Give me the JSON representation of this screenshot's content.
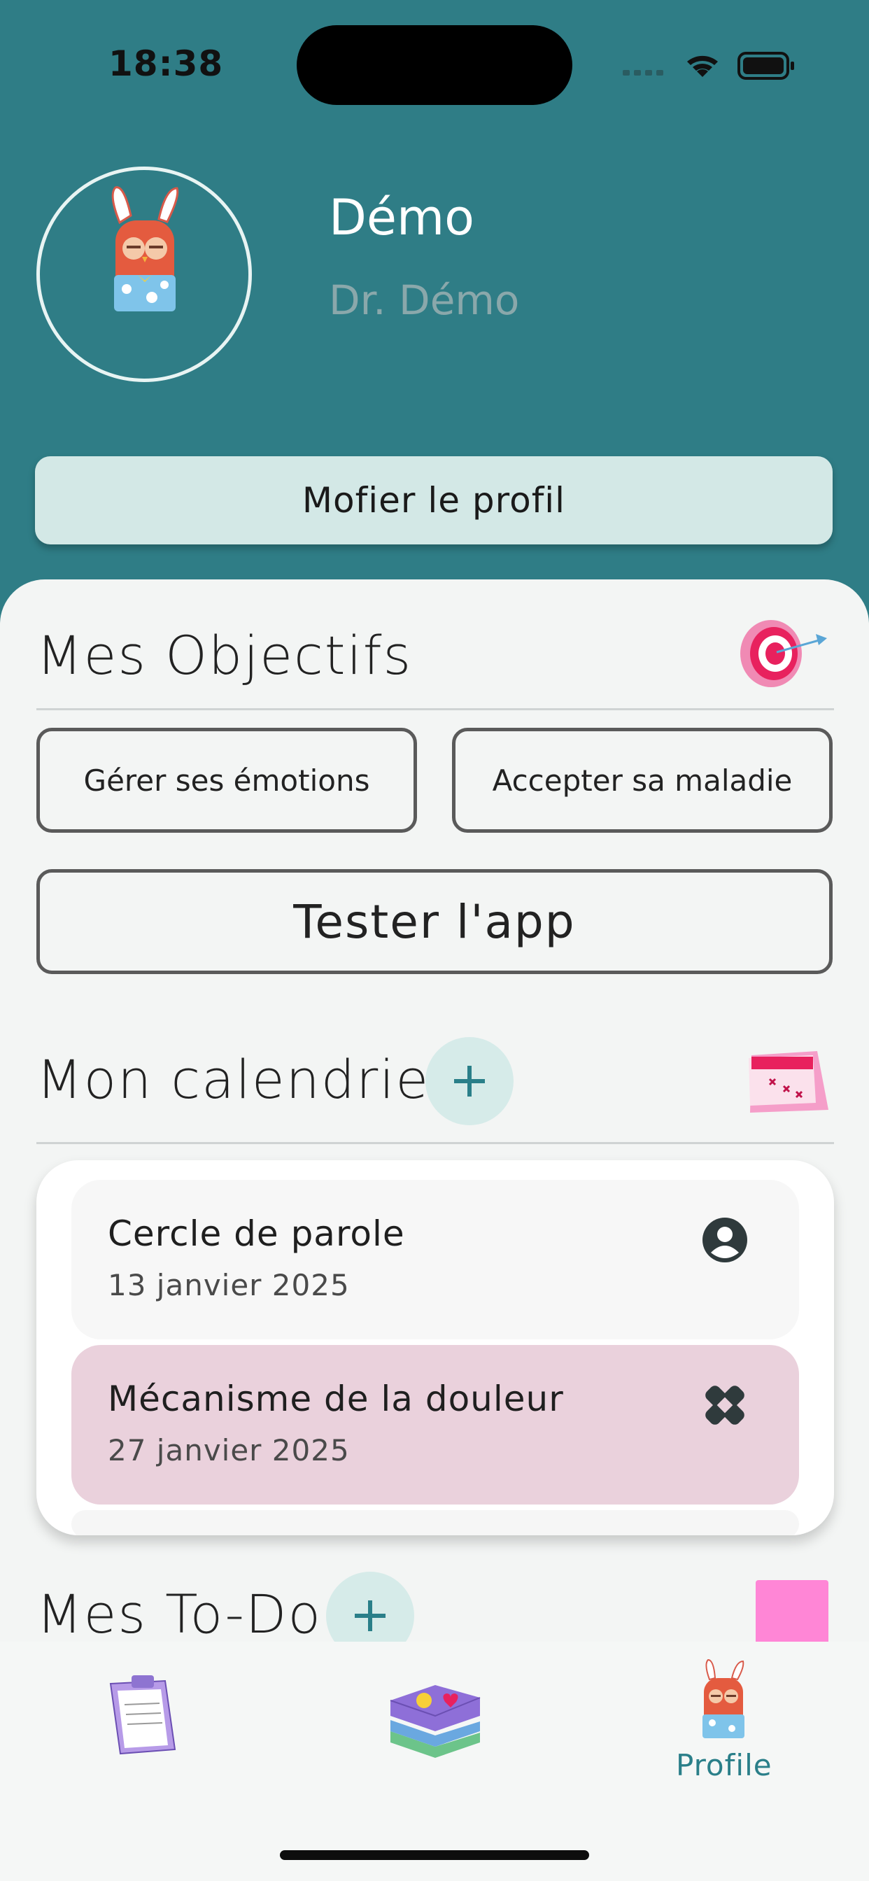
{
  "status_bar": {
    "time": "18:38"
  },
  "profile": {
    "name": "Démo",
    "subtitle": "Dr. Démo",
    "edit_label": "Mofier le profil"
  },
  "objectives": {
    "title": "Mes Objectifs",
    "items": [
      "Gérer ses émotions",
      "Accepter sa maladie",
      "Tester l'app"
    ]
  },
  "calendar": {
    "title": "Mon calendrier",
    "events": [
      {
        "title": "Cercle de parole",
        "date": "13 janvier 2025",
        "icon": "person-circle-icon",
        "color": "#f7f7f7"
      },
      {
        "title": "Mécanisme de la douleur",
        "date": "27 janvier 2025",
        "icon": "bandage-icon",
        "color": "#ead1dc"
      }
    ]
  },
  "todo": {
    "title": "Mes To-Do"
  },
  "bottom_nav": {
    "items": [
      {
        "icon": "clipboard-icon"
      },
      {
        "icon": "books-icon"
      },
      {
        "icon": "owl-avatar-icon",
        "label": "Profile"
      }
    ]
  },
  "colors": {
    "header_bg": "#2f7d86",
    "accent": "#2a7f89",
    "plus_bg": "#d6ebe9",
    "event_pink": "#ead1dc"
  }
}
